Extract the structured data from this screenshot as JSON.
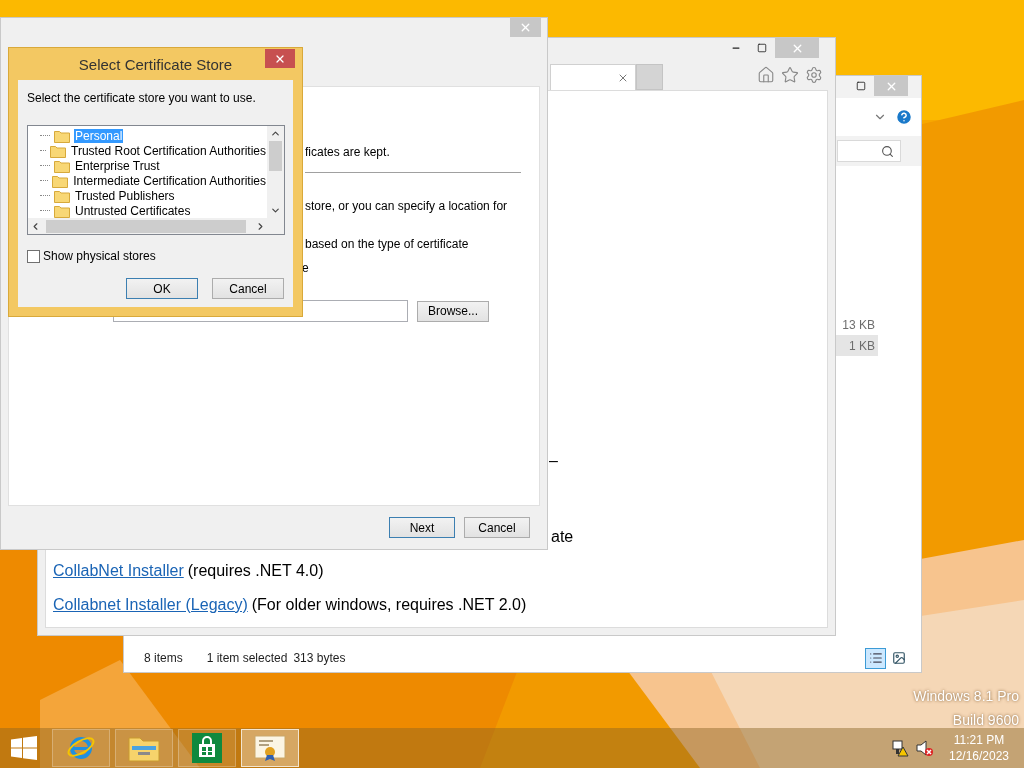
{
  "desktop": {
    "edition": "Windows 8.1 Pro",
    "build": "Build 9600"
  },
  "explorer_window": {
    "file_sizes": [
      {
        "size": "13 KB",
        "selected": false
      },
      {
        "size": "1 KB",
        "selected": true
      }
    ],
    "status_bar": {
      "item_count": "8 items",
      "selection": "1 item selected",
      "selection_size": "313 bytes"
    },
    "view_buttons": [
      {
        "kind": "details",
        "selected": true
      },
      {
        "kind": "preview",
        "selected": false
      }
    ]
  },
  "browser_window": {
    "fragments": [
      "–",
      "ate"
    ],
    "links": [
      {
        "link": "CollabNet Installer",
        "note": "(requires .NET 4.0)"
      },
      {
        "link": "Collabnet Installer (Legacy)",
        "note": "(For older windows, requires .NET 2.0)"
      }
    ]
  },
  "wizard": {
    "text_lines": [
      "ficates are kept.",
      "store, or you can specify a location for",
      "based on the type of certificate",
      "e"
    ],
    "browse_button": "Browse...",
    "buttons": [
      {
        "label": "Next",
        "default": true
      },
      {
        "label": "Cancel",
        "default": false
      }
    ]
  },
  "store_dialog": {
    "title": "Select Certificate Store",
    "prompt": "Select the certificate store you want to use.",
    "stores": [
      {
        "label": "Personal",
        "selected": true
      },
      {
        "label": "Trusted Root Certification Authorities",
        "selected": false
      },
      {
        "label": "Enterprise Trust",
        "selected": false
      },
      {
        "label": "Intermediate Certification Authorities",
        "selected": false
      },
      {
        "label": "Trusted Publishers",
        "selected": false
      },
      {
        "label": "Untrusted Certificates",
        "selected": false
      }
    ],
    "show_physical_stores": {
      "label": "Show physical stores",
      "checked": false
    },
    "buttons": [
      {
        "label": "OK",
        "default": true
      },
      {
        "label": "Cancel",
        "default": false
      }
    ]
  },
  "taskbar": {
    "apps": [
      {
        "kind": "internet_explorer",
        "active": false
      },
      {
        "kind": "file_explorer",
        "active": false
      },
      {
        "kind": "store",
        "active": false
      },
      {
        "kind": "certificate",
        "active": true
      }
    ],
    "clock": {
      "time": "11:21 PM",
      "date": "12/16/2023"
    }
  }
}
